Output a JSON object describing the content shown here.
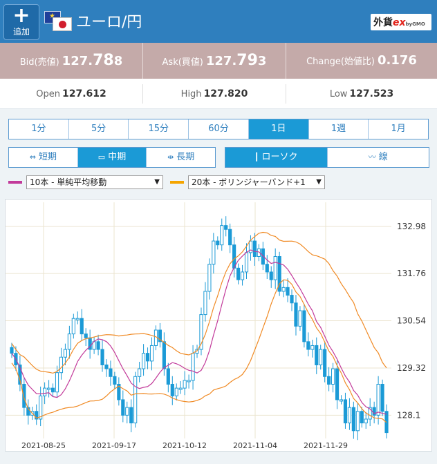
{
  "header": {
    "add_label": "追加",
    "add_icon": "plus-icon",
    "pair_title": "ユーロ/円",
    "logo_main": "外貨",
    "logo_ex": "ex",
    "logo_sub": "byGMO"
  },
  "quotes": {
    "bid_label": "Bid(売値)",
    "bid_a": "127.",
    "bid_b": "78",
    "bid_c": "8",
    "ask_label": "Ask(買値)",
    "ask_a": "127.",
    "ask_b": "79",
    "ask_c": "3",
    "change_label": "Change(始値比)",
    "change_value": "0.176"
  },
  "ohl": {
    "open_label": "Open",
    "open_value": "127.612",
    "high_label": "High",
    "high_value": "127.820",
    "low_label": "Low",
    "low_value": "127.523"
  },
  "timeframes": [
    "1分",
    "5分",
    "15分",
    "60分",
    "1日",
    "1週",
    "1月"
  ],
  "active_timeframe": "1日",
  "terms": [
    {
      "label": "短期",
      "icon": "arrows-horizontal-icon"
    },
    {
      "label": "中期",
      "icon": "rectangle-icon"
    },
    {
      "label": "長期",
      "icon": "arrows-outward-icon"
    }
  ],
  "active_term": "中期",
  "chart_types": [
    {
      "label": "ローソク",
      "icon": "candlestick-icon"
    },
    {
      "label": "線",
      "icon": "line-chart-icon"
    }
  ],
  "active_chart_type": "ローソク",
  "indicators": [
    {
      "label": "10本 - 単純平均移動",
      "color": "#c23a9a"
    },
    {
      "label": "20本 - ボリンジャーバンド+1",
      "color": "#f5a500"
    }
  ],
  "chart_data": {
    "type": "candlestick",
    "x_tick_labels": [
      "2021-08-25",
      "2021-09-17",
      "2021-10-12",
      "2021-11-04",
      "2021-11-29"
    ],
    "y_tick_labels": [
      "132.98",
      "131.76",
      "130.54",
      "129.32",
      "128.1"
    ],
    "y_ticks": [
      132.98,
      131.76,
      130.54,
      129.32,
      128.1
    ],
    "ylim": [
      127.5,
      133.6
    ],
    "grid": true,
    "candle_color": "#1b9ad6",
    "sma_color": "#c23a9a",
    "band_color": "#f08a24",
    "closes": [
      129.7,
      129.4,
      128.9,
      128.3,
      128.1,
      128.2,
      128.0,
      128.6,
      128.8,
      128.8,
      128.7,
      129.2,
      129.6,
      129.8,
      130.2,
      130.6,
      130.6,
      130.2,
      130.1,
      129.8,
      130.0,
      129.8,
      129.4,
      129.3,
      129.1,
      128.9,
      128.5,
      128.1,
      128.3,
      127.9,
      129.1,
      129.3,
      129.7,
      129.5,
      129.9,
      130.3,
      130.0,
      129.3,
      128.9,
      128.6,
      128.8,
      128.8,
      129.0,
      129.0,
      129.7,
      129.8,
      130.7,
      131.3,
      132.0,
      132.6,
      132.5,
      133.0,
      132.9,
      132.5,
      131.9,
      131.6,
      131.8,
      132.3,
      132.6,
      132.2,
      132.4,
      132.0,
      131.8,
      131.6,
      132.2,
      131.3,
      131.4,
      131.2,
      131.0,
      130.4,
      130.8,
      130.0,
      129.8,
      129.9,
      129.4,
      129.8,
      129.1,
      128.9,
      129.3,
      128.5,
      128.5,
      127.9,
      128.3,
      127.7,
      128.2,
      127.9,
      128.0,
      128.3,
      128.1,
      128.9,
      128.2,
      127.65
    ]
  }
}
